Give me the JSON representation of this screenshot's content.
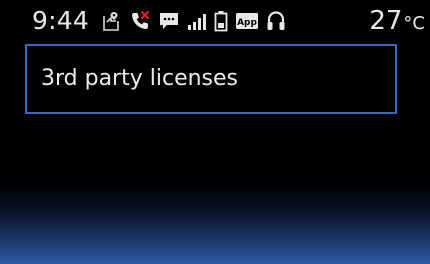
{
  "status_bar": {
    "time": "9:44",
    "temperature": "27",
    "temperature_unit": "°C",
    "icons": [
      "navigation-icon",
      "phone-missed-icon",
      "message-icon",
      "signal-icon",
      "battery-icon",
      "app-icon",
      "headphones-icon"
    ],
    "app_icon_label": "App"
  },
  "menu": {
    "items": [
      {
        "label": "3rd party licenses"
      }
    ]
  },
  "colors": {
    "selection_border": "#3c68b8",
    "phone_icon": "#e02020",
    "background_glow": "#2f5ea8"
  }
}
